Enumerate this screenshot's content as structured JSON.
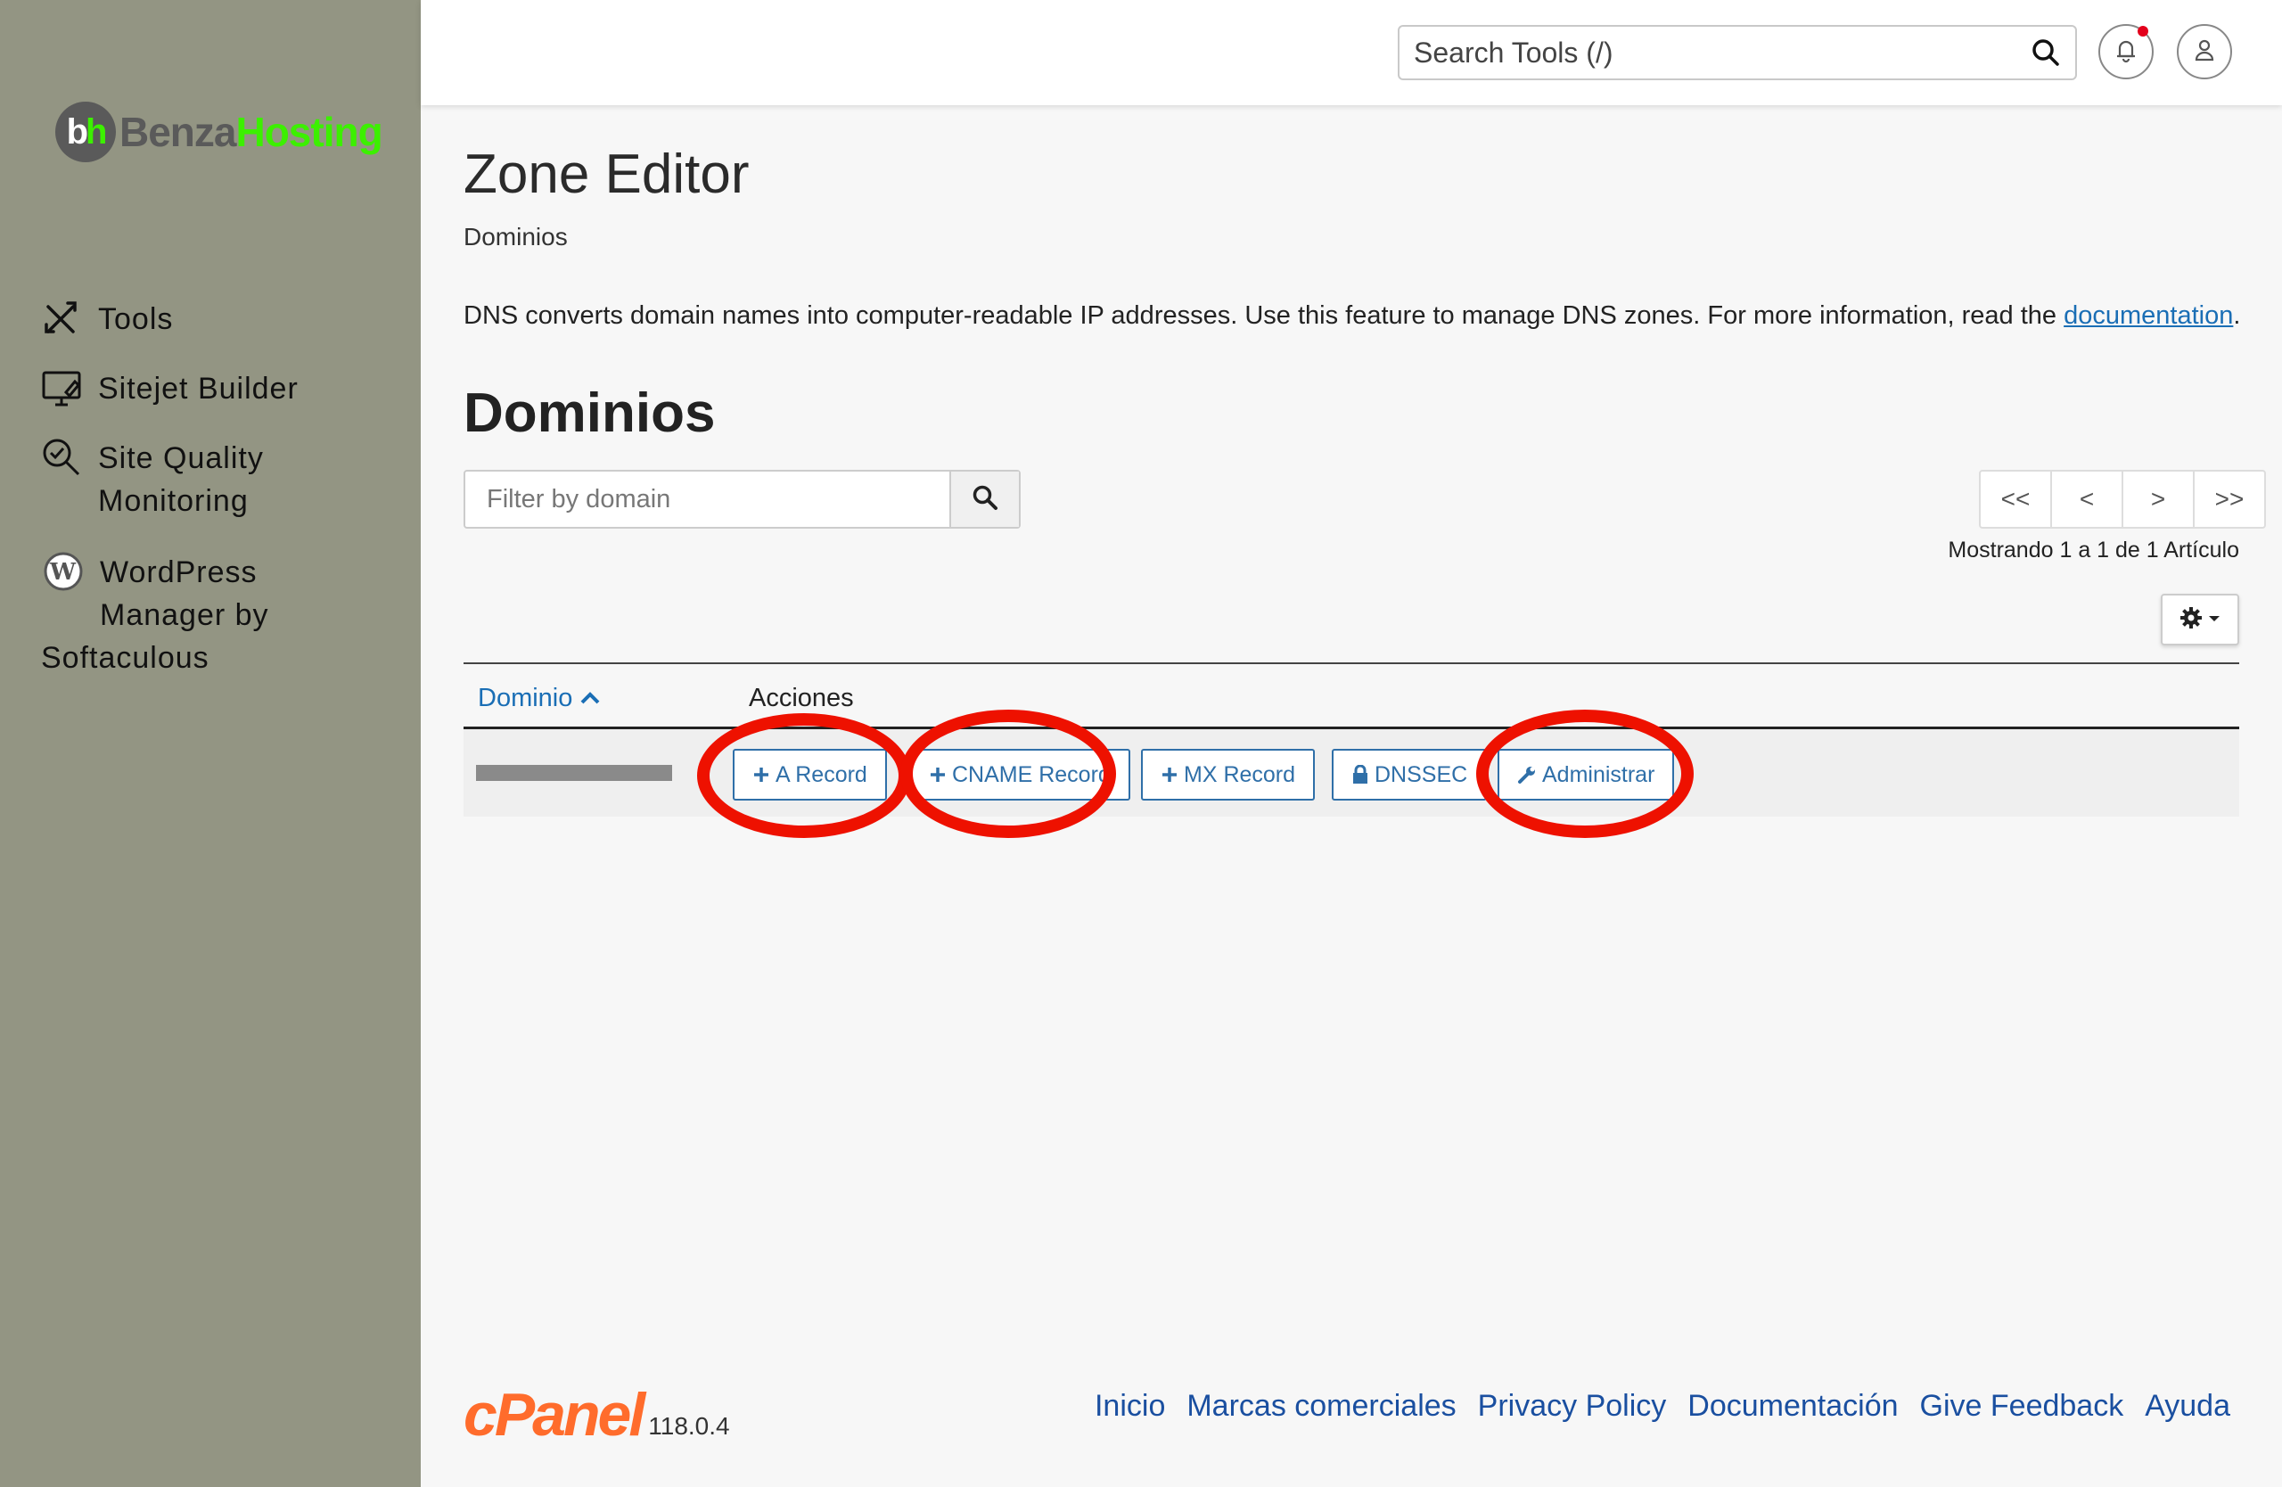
{
  "colors": {
    "sidebar": "#939583",
    "link": "#1a6eb5",
    "accent_green": "#3cf000",
    "annotation_red": "#ee1100",
    "cpanel_orange": "#ff6c2c"
  },
  "logo": {
    "badge_b": "b",
    "badge_h": "h",
    "benza": "Benza",
    "hosting": "Hosting"
  },
  "sidebar": {
    "items": [
      {
        "label": "Tools",
        "icon": "tools-icon"
      },
      {
        "label": "Sitejet Builder",
        "icon": "monitor-icon"
      },
      {
        "label_line1": "Site Quality",
        "label_line2": "Monitoring",
        "icon": "magnifier-check-icon"
      },
      {
        "label_line1": "WordPress",
        "label_line2": "Manager by",
        "label_line3": "Softaculous",
        "icon": "wordpress-icon"
      }
    ]
  },
  "header": {
    "search_placeholder": "Search Tools (/)"
  },
  "page": {
    "title": "Zone Editor",
    "subtitle": "Dominios",
    "description": "DNS converts domain names into computer-readable IP addresses. Use this feature to manage DNS zones. For more information, read the ",
    "description_link": "documentation",
    "description_end": "."
  },
  "domains": {
    "title": "Dominios",
    "filter_placeholder": "Filter by domain",
    "pager": {
      "first": "<<",
      "prev": "<",
      "next": ">",
      "last": ">>"
    },
    "status": "Mostrando 1 a 1 de 1 Artículo",
    "columns": {
      "domain": "Dominio",
      "actions": "Acciones"
    },
    "actions": {
      "a_record": "A Record",
      "cname_record": "CNAME Record",
      "mx_record": "MX Record",
      "dnssec": "DNSSEC",
      "manage": "Administrar"
    }
  },
  "footer": {
    "brand": "cPanel",
    "version": "118.0.4",
    "links": [
      "Inicio",
      "Marcas comerciales",
      "Privacy Policy",
      "Documentación",
      "Give Feedback",
      "Ayuda"
    ]
  }
}
